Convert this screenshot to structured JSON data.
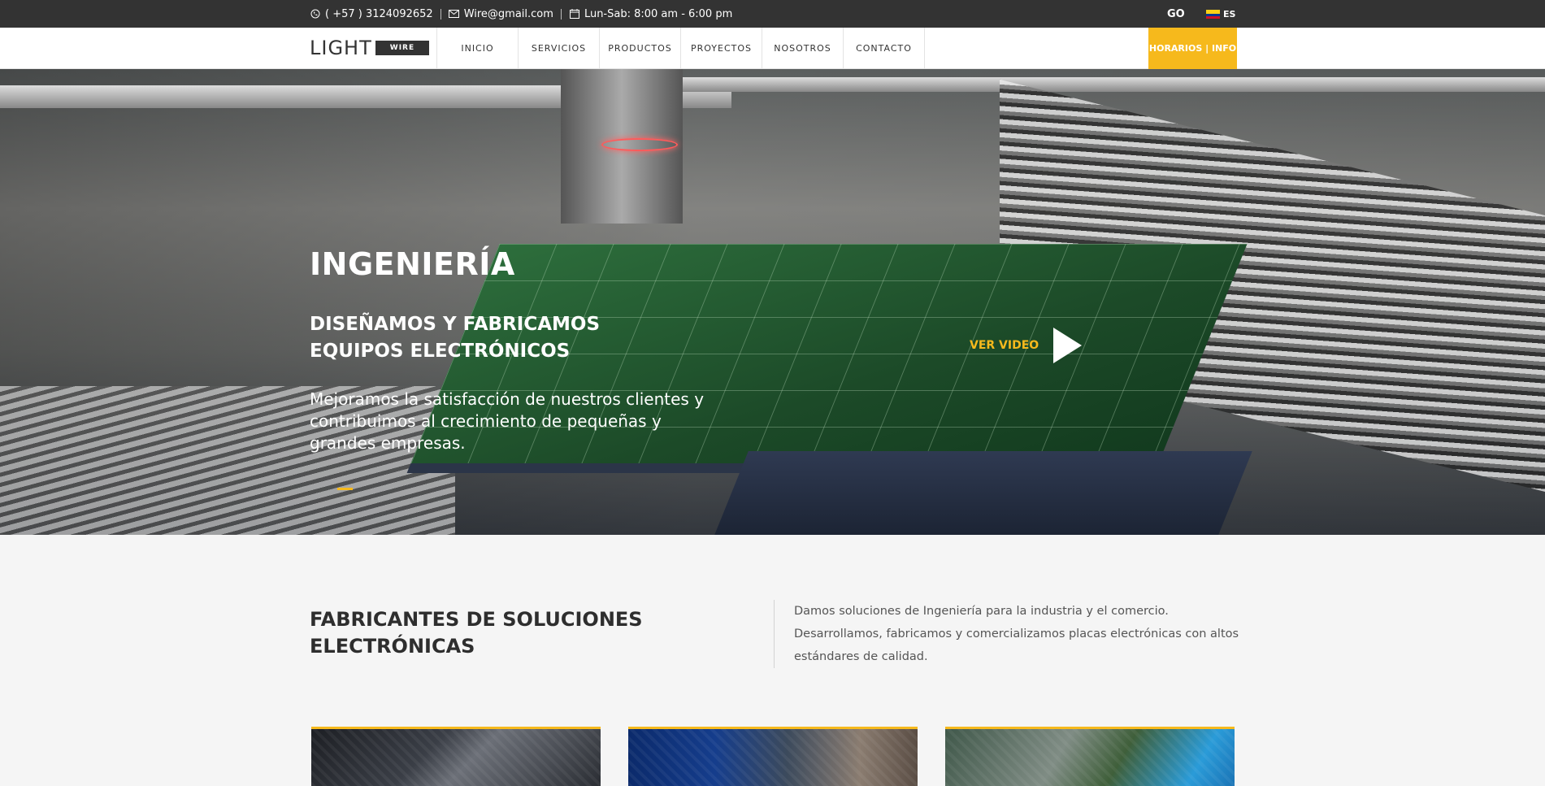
{
  "topbar": {
    "phone": "( +57 ) 3124092652",
    "email": "Wire@gmail.com",
    "hours": "Lun-Sab: 8:00 am - 6:00 pm",
    "lang_go": "GO",
    "lang_es": "ES",
    "flag_colors": [
      "#fcd116",
      "#003893",
      "#ce1126"
    ]
  },
  "header": {
    "logo_main": "LIGHT",
    "logo_sub": "WIRE",
    "nav": [
      "INICIO",
      "SERVICIOS",
      "PRODUCTOS",
      "PROYECTOS",
      "NOSOTROS",
      "CONTACTO"
    ],
    "hours_button": "HORARIOS | INFO"
  },
  "hero": {
    "title": "INGENIERÍA",
    "subtitle": "DISEÑAMOS Y FABRICAMOS EQUIPOS ELECTRÓNICOS",
    "description": "Mejoramos la satisfacción de nuestros clientes y contribuimos al crecimiento de pequeñas y grandes empresas.",
    "video_label": "VER VIDEO"
  },
  "intro": {
    "title": "FABRICANTES DE SOLUCIONES ELECTRÓNICAS",
    "text": "Damos soluciones de Ingeniería para la industria y el comercio. Desarrollamos, fabricamos y comercializamos placas electrónicas con altos estándares de calidad."
  },
  "colors": {
    "accent": "#f6b91c",
    "topbar_bg": "#333333",
    "page_bg": "#f5f5f5"
  }
}
